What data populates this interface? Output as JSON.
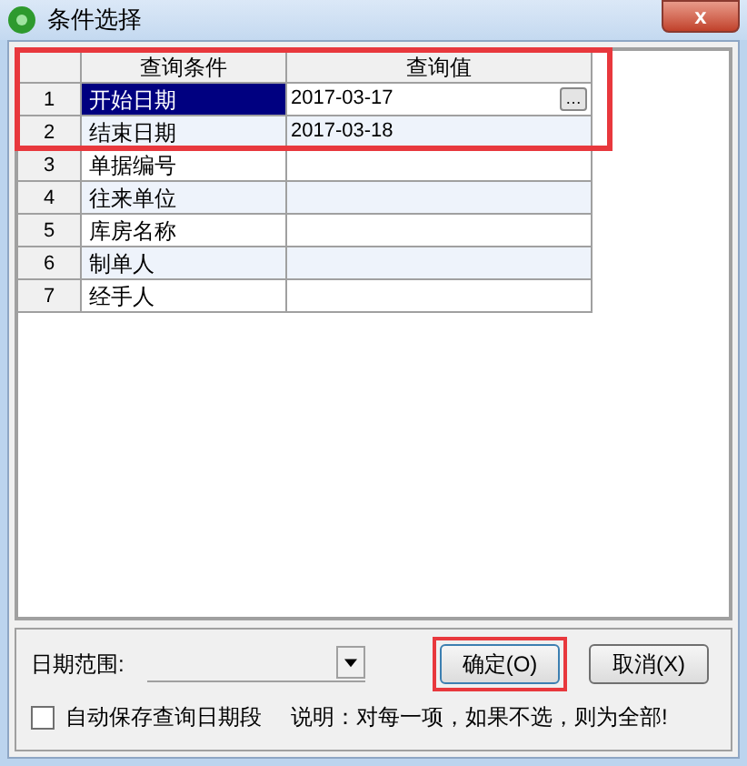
{
  "window": {
    "title": "条件选择",
    "close": "x"
  },
  "table": {
    "highlighted": true,
    "columns": [
      "查询条件",
      "查询值"
    ],
    "rows": [
      {
        "index": "1",
        "condition": "开始日期",
        "value": "2017-03-17",
        "selected": true,
        "button": "…"
      },
      {
        "index": "2",
        "condition": "结束日期",
        "value": "2017-03-18",
        "selected": false
      },
      {
        "index": "3",
        "condition": "单据编号",
        "selected": false
      },
      {
        "index": "4",
        "condition": "往来单位",
        "selected": false
      },
      {
        "index": "5",
        "condition": "库房名称",
        "selected": false
      },
      {
        "index": "6",
        "condition": "制单人",
        "selected": false
      },
      {
        "index": "7",
        "condition": "经手人",
        "selected": false
      }
    ]
  },
  "date_range": {
    "label": "日期范围:"
  },
  "buttons": [
    {
      "label": "确定(O)",
      "highlighted": true
    },
    {
      "label": "取消(X)",
      "highlighted": false
    }
  ],
  "auto_save": {
    "label": "自动保存查询日期段",
    "checked": false
  },
  "note": "说明：对每一项，如果不选，则为全部!"
}
